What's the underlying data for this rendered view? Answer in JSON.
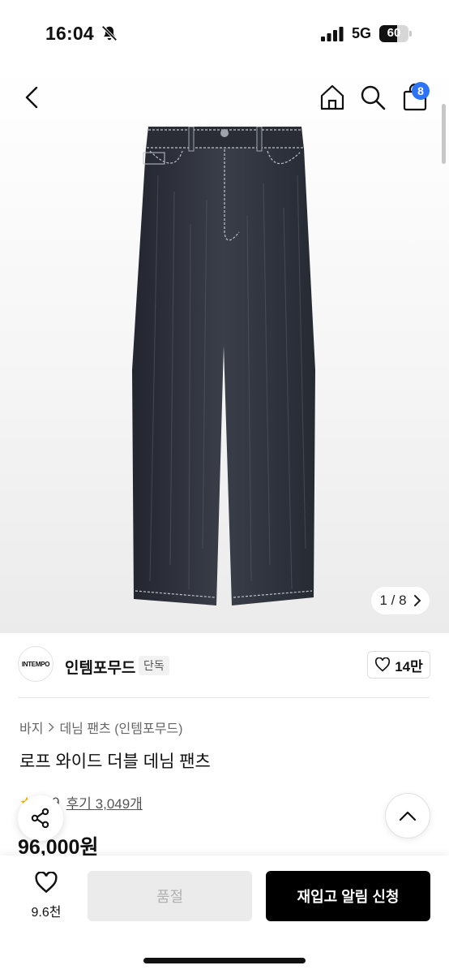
{
  "status_bar": {
    "time": "16:04",
    "network": "5G",
    "battery": "60",
    "battery_level": 0.6,
    "icons": [
      "bell-off-icon",
      "signal-icon",
      "battery-icon"
    ]
  },
  "nav": {
    "cart_count": "8",
    "icons": [
      "back-arrow-icon",
      "home-icon",
      "search-icon",
      "shopping-bag-icon"
    ]
  },
  "gallery": {
    "page_indicator": "1 / 8"
  },
  "brand": {
    "logo_text": "INTEMPO",
    "name": "인템포무드",
    "tag": "단독",
    "likes": "14만"
  },
  "product": {
    "breadcrumb": [
      "바지",
      "데님 팬츠 (인템포무드)"
    ],
    "title": "로프 와이드 더블 데님 팬츠",
    "rating": "4.9",
    "reviews": "후기 3,049개",
    "price": "96,000원"
  },
  "bottom_bar": {
    "wish_count": "9.6천",
    "sold_out_label": "품절",
    "restock_label": "재입고 알림 신청"
  },
  "colors": {
    "badge": "#2d73f5",
    "primary_button": "#000000",
    "disabled_button": "#ebebeb",
    "star": "#f5b400"
  }
}
